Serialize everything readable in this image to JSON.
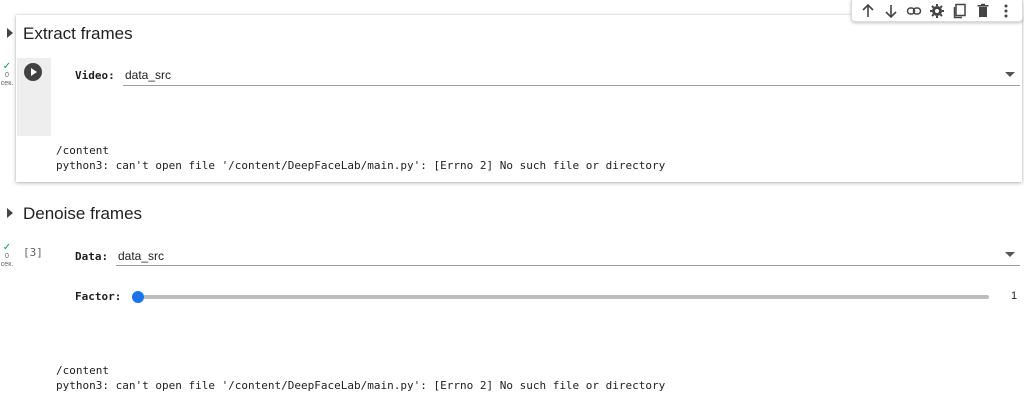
{
  "toolbar": {
    "icons": [
      "arrow-up-icon",
      "arrow-down-icon",
      "link-icon",
      "gear-icon",
      "mirror-cell-icon",
      "trash-icon",
      "more-vert-icon"
    ]
  },
  "cell1": {
    "title": "Extract frames",
    "status_value": "0",
    "status_unit": "сек.",
    "video_label": "Video:",
    "video_value": "data_src",
    "output_line1": "/content",
    "output_line2": "python3: can't open file '/content/DeepFaceLab/main.py': [Errno 2] No such file or directory"
  },
  "cell2": {
    "title": "Denoise frames",
    "status_value": "0",
    "status_unit": "сек.",
    "exec_count": "[3]",
    "data_label": "Data:",
    "data_value": "data_src",
    "factor_label": "Factor:",
    "factor_value": "1",
    "factor_fraction": 0.0,
    "output_line1": "/content",
    "output_line2": "python3: can't open file '/content/DeepFaceLab/main.py': [Errno 2] No such file or directory"
  },
  "colors": {
    "accent": "#1a73e8",
    "success": "#0f9d58"
  }
}
